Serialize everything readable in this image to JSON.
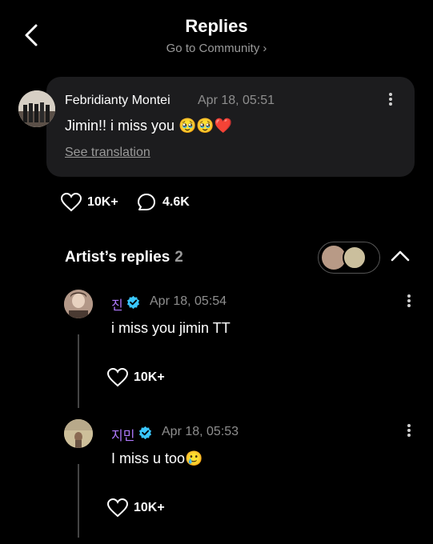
{
  "header": {
    "title": "Replies",
    "subtitle": "Go to Community",
    "subtitle_chevron": "›"
  },
  "post": {
    "author": "Febridianty Montei",
    "time": "Apr 18, 05:51",
    "message": "Jimin!! i miss you 🥹🥹❤️",
    "see_translation": "See translation",
    "likes": "10K+",
    "comments": "4.6K"
  },
  "artist_replies": {
    "label": "Artist’s replies",
    "count": "2",
    "items": [
      {
        "name": "진",
        "time": "Apr 18, 05:54",
        "message": "i miss you jimin TT",
        "likes": "10K+"
      },
      {
        "name": "지민",
        "time": "Apr 18, 05:53",
        "message": "I miss u too🥲",
        "likes": "10K+"
      }
    ]
  },
  "colors": {
    "background": "#000000",
    "bubble": "#1c1c1e",
    "artist_name": "#b07aff",
    "verified": "#3ac7ff",
    "like_red": "#e22a2a"
  },
  "icons": [
    "back-arrow-icon",
    "heart-icon",
    "comment-icon",
    "kebab-icon",
    "verified-badge-icon",
    "chevron-up-icon"
  ]
}
